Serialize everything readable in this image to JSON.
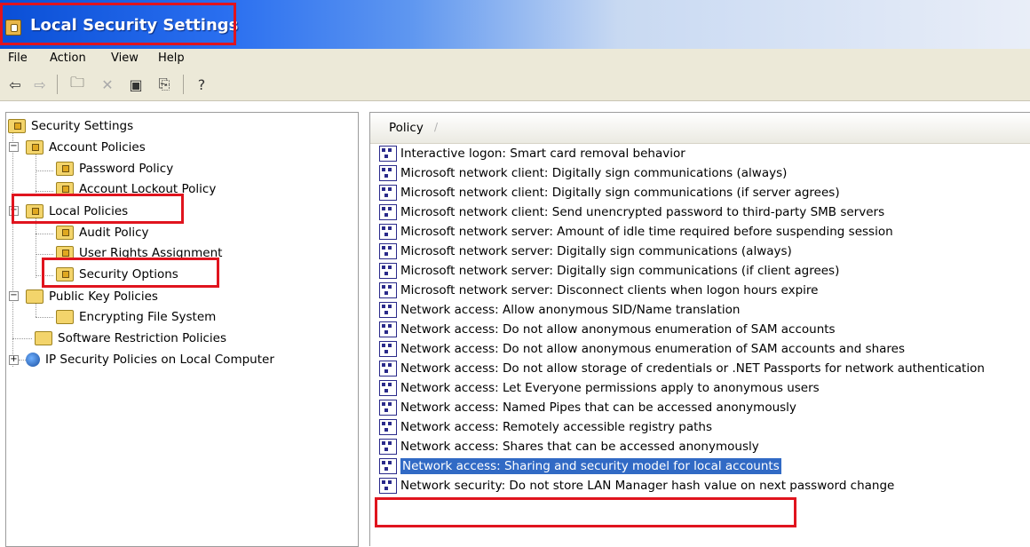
{
  "window": {
    "title": "Local Security Settings",
    "icon": "security-settings-icon"
  },
  "menu": [
    "File",
    "Action",
    "View",
    "Help"
  ],
  "toolbar": {
    "icons": [
      "back-arrow-icon",
      "forward-arrow-icon",
      "up-folder-icon",
      "delete-icon",
      "properties-icon",
      "export-list-icon",
      "help-icon"
    ]
  },
  "tree": {
    "root": "Security Settings",
    "items": [
      "Account Policies",
      "Password Policy",
      "Account Lockout Policy",
      "Local Policies",
      "Audit Policy",
      "User Rights Assignment",
      "Security Options",
      "Public Key Policies",
      "Encrypting File System",
      "Software Restriction Policies",
      "IP Security Policies on Local Computer"
    ],
    "selected": "Security Options"
  },
  "list": {
    "column_header": "Policy",
    "sort_indicator": "/",
    "rows": [
      "Interactive logon: Smart card removal behavior",
      "Microsoft network client: Digitally sign communications (always)",
      "Microsoft network client: Digitally sign communications (if server agrees)",
      "Microsoft network client: Send unencrypted password to third-party SMB servers",
      "Microsoft network server: Amount of idle time required before suspending session",
      "Microsoft network server: Digitally sign communications (always)",
      "Microsoft network server: Digitally sign communications (if client agrees)",
      "Microsoft network server: Disconnect clients when logon hours expire",
      "Network access: Allow anonymous SID/Name translation",
      "Network access: Do not allow anonymous enumeration of SAM accounts",
      "Network access: Do not allow anonymous enumeration of SAM accounts and shares",
      "Network access: Do not allow storage of credentials or .NET Passports for network authentication",
      "Network access: Let Everyone permissions apply to anonymous users",
      "Network access: Named Pipes that can be accessed anonymously",
      "Network access: Remotely accessible registry paths",
      "Network access: Shares that can be accessed anonymously",
      "Network access: Sharing and security model for local accounts",
      "Network security: Do not store LAN Manager hash value on next password change"
    ],
    "selected": "Network access: Sharing and security model for local accounts"
  },
  "colors": {
    "highlight_box": "#e0141e",
    "selection": "#316ac5",
    "titlebar_start": "#0a4fd6"
  }
}
